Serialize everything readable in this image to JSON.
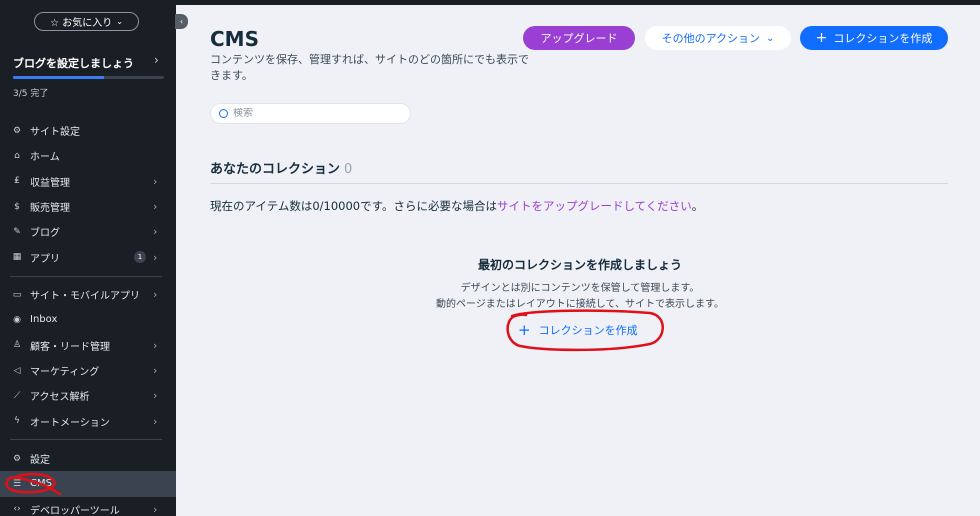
{
  "sidebar": {
    "favorites_label": "☆ お気に入り",
    "setup": {
      "title": "ブログを設定しましょう",
      "status": "3/5 完了",
      "progress": 0.6
    },
    "items": [
      {
        "label": "サイト設定",
        "icon": "gear-check-icon"
      },
      {
        "label": "ホーム",
        "icon": "home-icon"
      },
      {
        "label": "収益管理",
        "icon": "revenue-icon",
        "chevron": true
      },
      {
        "label": "販売管理",
        "icon": "dollar-icon",
        "chevron": true
      },
      {
        "label": "ブログ",
        "icon": "pen-icon",
        "chevron": true
      },
      {
        "label": "アプリ",
        "icon": "apps-icon",
        "badge": "1",
        "chevron": true
      },
      {
        "label": "サイト・モバイルアプリ",
        "icon": "devices-icon",
        "chevron": true
      },
      {
        "label": "Inbox",
        "icon": "inbox-icon"
      },
      {
        "label": "顧客・リード管理",
        "icon": "contacts-icon",
        "chevron": true
      },
      {
        "label": "マーケティング",
        "icon": "megaphone-icon",
        "chevron": true
      },
      {
        "label": "アクセス解析",
        "icon": "analytics-icon",
        "chevron": true
      },
      {
        "label": "オートメーション",
        "icon": "bolt-icon",
        "chevron": true
      },
      {
        "label": "設定",
        "icon": "settings-icon"
      },
      {
        "label": "CMS",
        "icon": "cms-icon",
        "active": true
      },
      {
        "label": "デベロッパーツール",
        "icon": "code-icon",
        "chevron": true
      }
    ]
  },
  "header": {
    "title": "CMS",
    "description": "コンテンツを保存、管理すれば、サイトのどの箇所にでも表示できます。",
    "upgrade_label": "アップグレード",
    "more_actions_label": "その他のアクション",
    "create_label": "コレクションを作成"
  },
  "search": {
    "placeholder": "検索"
  },
  "collections": {
    "heading": "あなたのコレクション",
    "count": "0",
    "items_text": "現在のアイテム数は0/10000です。さらに必要な場合は",
    "upgrade_link": "サイトをアップグレードしてください",
    "items_end": "。"
  },
  "empty_state": {
    "title": "最初のコレクションを作成しましょう",
    "line1": "デザインとは別にコンテンツを保管して管理します。",
    "line2": "動的ページまたはレイアウトに接続して、サイトで表示します。",
    "create_link": "コレクションを作成"
  },
  "colors": {
    "accent": "#116dff",
    "upgrade": "#9a3fd3",
    "sidebar": "#1a1f26",
    "annotation": "#e0101a"
  }
}
